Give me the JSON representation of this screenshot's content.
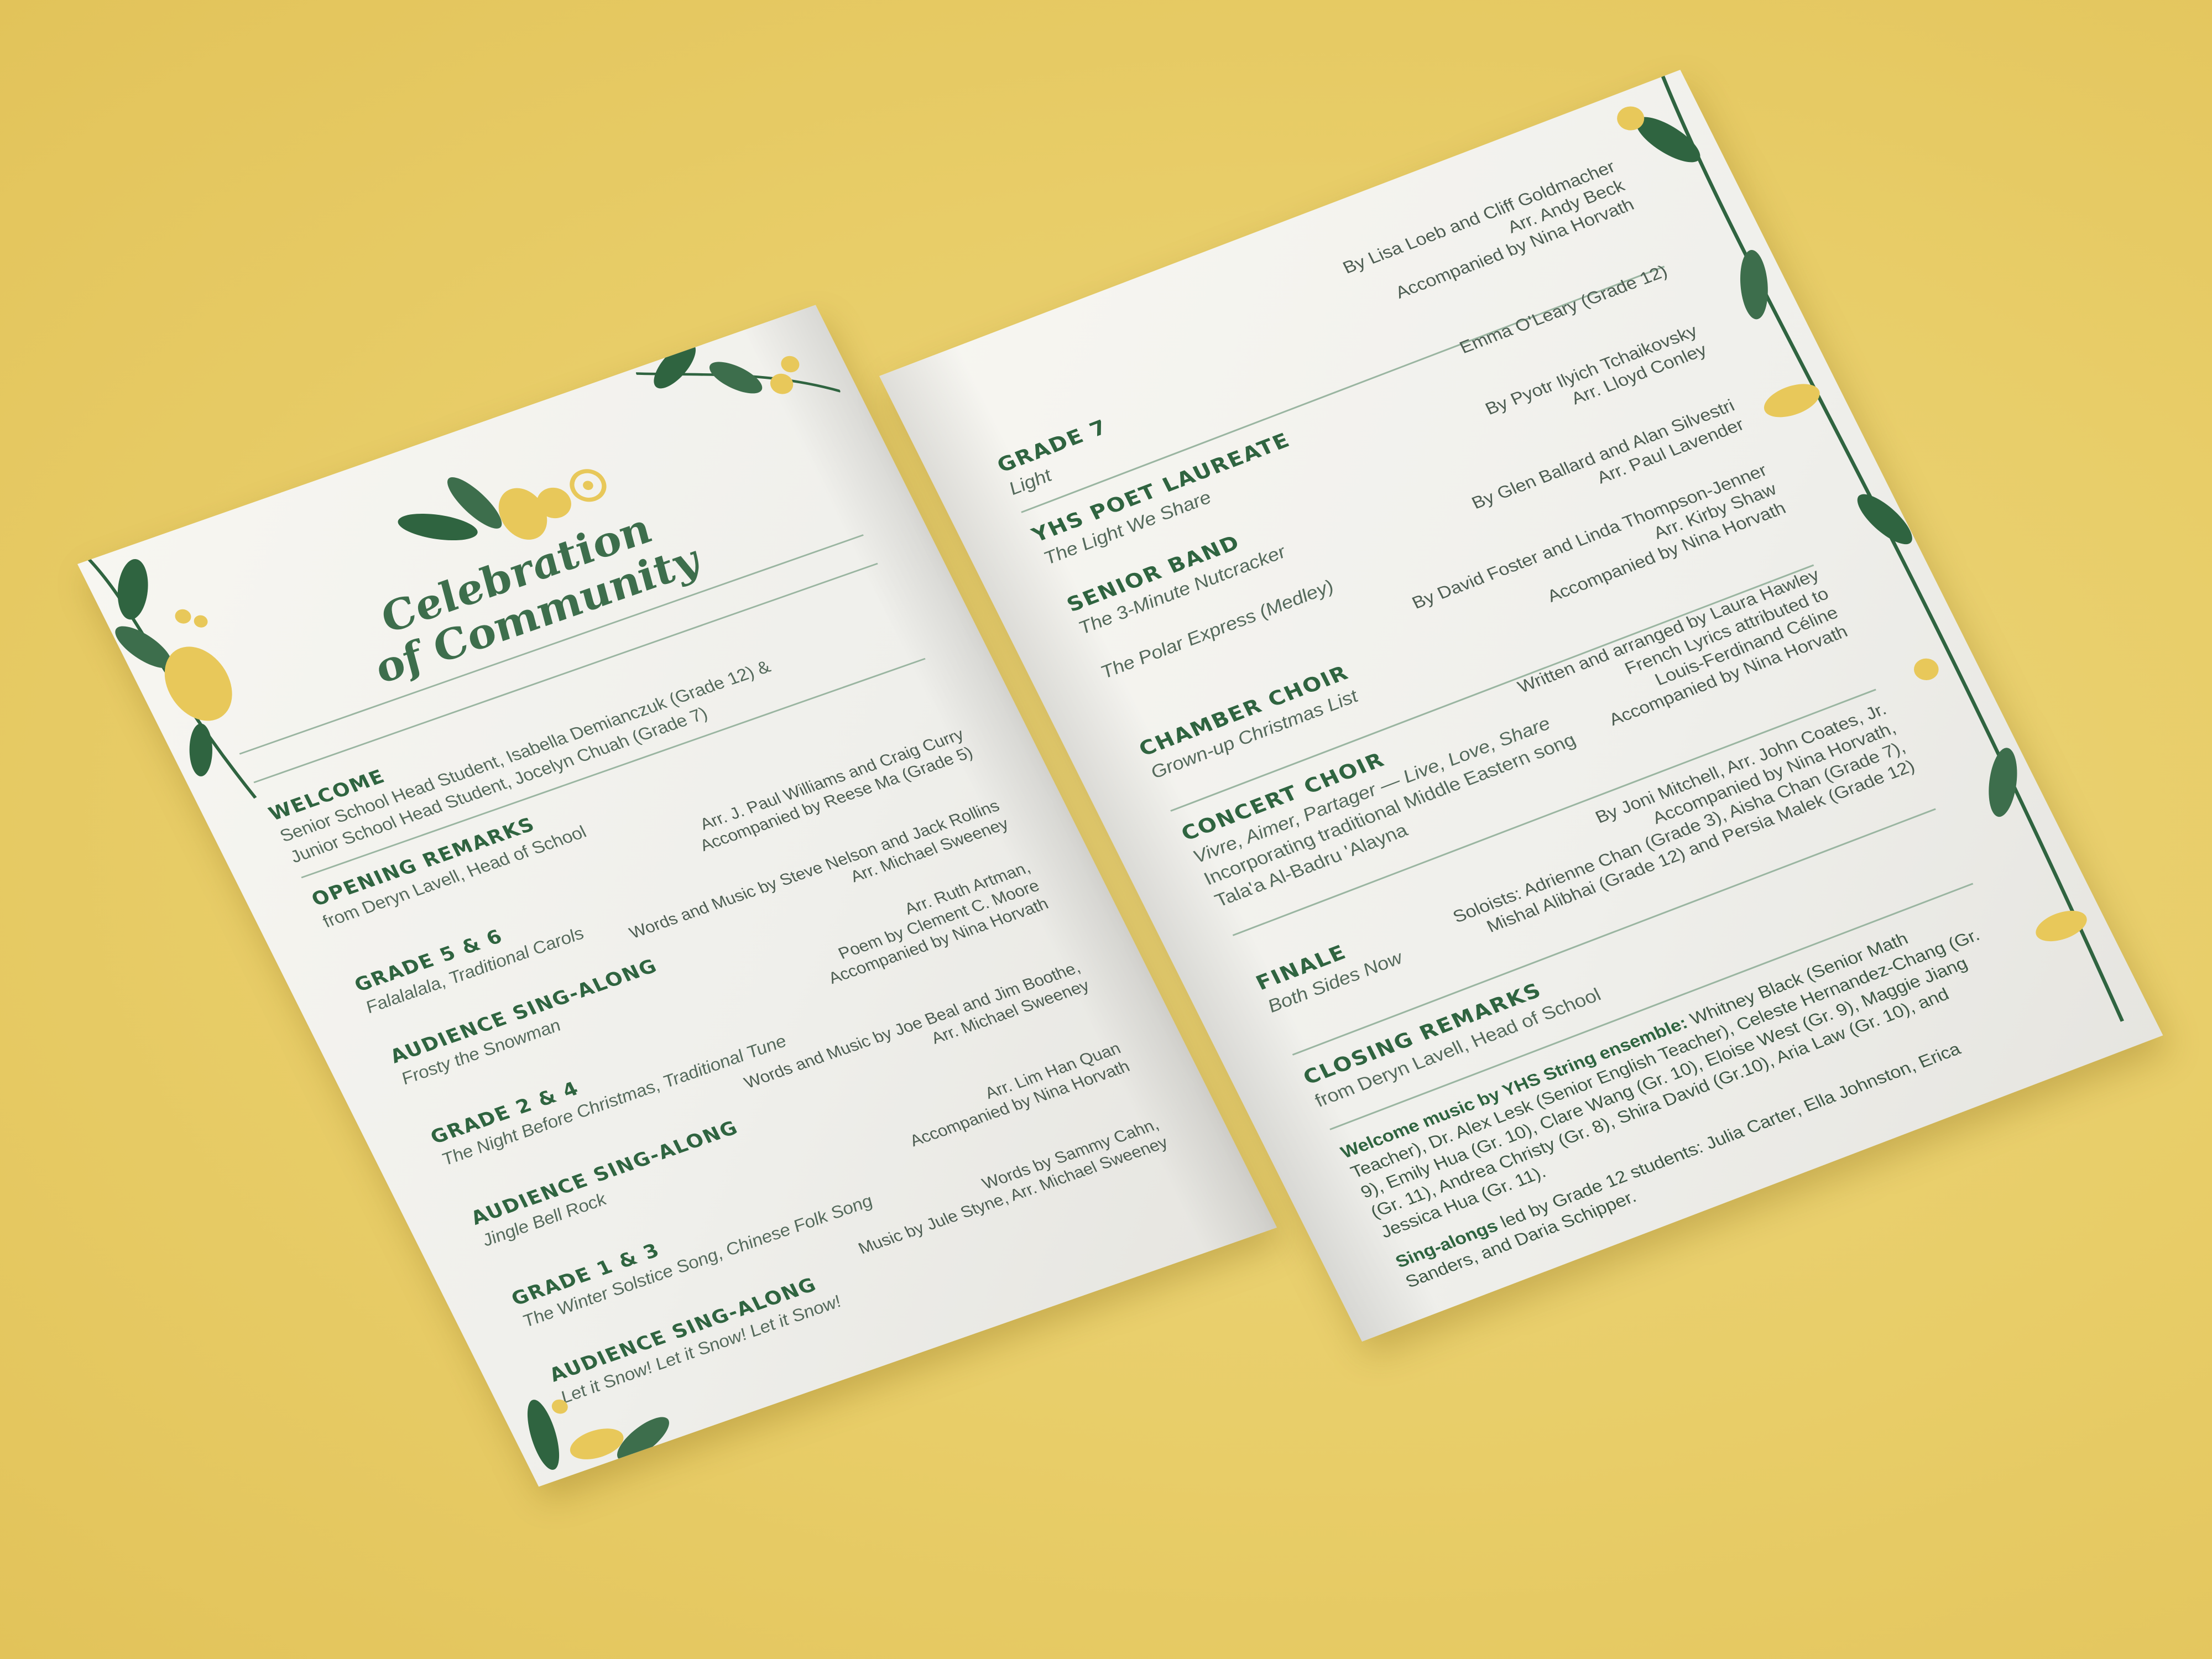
{
  "colors": {
    "background": "#e8cd68",
    "accent_green": "#2f6440",
    "accent_yellow": "#e8c85a",
    "paper": "#f4f3ee"
  },
  "title": {
    "line1": "Celebration",
    "line2": "of Community"
  },
  "left_items": [
    {
      "heading": "WELCOME",
      "sub": [
        "Senior School Head Student, Isabella Demianczuk (Grade 12) &",
        "Junior School Head Student, Jocelyn Chuah (Grade 7)"
      ],
      "credits": []
    },
    {
      "heading": "OPENING REMARKS",
      "sub": [
        "from Deryn Lavell, Head of School"
      ],
      "credits": []
    },
    {
      "heading": "GRADE 5 & 6",
      "sub": [
        "Falalalala, Traditional Carols"
      ],
      "credits": [
        "Arr. J. Paul Williams and Craig Curry",
        "Accompanied by Reese Ma (Grade 5)"
      ]
    },
    {
      "heading": "AUDIENCE SING-ALONG",
      "sub": [
        "Frosty the Snowman"
      ],
      "credits": [
        "Words and Music by Steve Nelson and Jack Rollins",
        "Arr. Michael Sweeney"
      ]
    },
    {
      "heading": "GRADE 2 & 4",
      "sub": [
        "The Night Before Christmas, Traditional Tune"
      ],
      "credits": [
        "Arr. Ruth Artman,",
        "Poem by Clement C. Moore",
        "Accompanied by Nina Horvath"
      ]
    },
    {
      "heading": "AUDIENCE SING-ALONG",
      "sub": [
        "Jingle Bell Rock"
      ],
      "credits": [
        "Words and Music by Joe Beal and Jim Boothe,",
        "Arr. Michael Sweeney"
      ]
    },
    {
      "heading": "GRADE 1 & 3",
      "sub": [
        "The Winter Solstice Song, Chinese Folk Song"
      ],
      "credits": [
        "Arr. Lim Han Quan",
        "Accompanied by Nina Horvath"
      ]
    },
    {
      "heading": "AUDIENCE SING-ALONG",
      "sub": [
        "Let it Snow! Let it Snow! Let it Snow!"
      ],
      "credits": [
        "Words by Sammy Cahn,",
        "Music by Jule Styne, Arr. Michael Sweeney"
      ]
    }
  ],
  "right_items": [
    {
      "heading": "GRADE 7",
      "sub": [
        "Light"
      ],
      "credits": [
        "By Lisa Loeb and Cliff Goldmacher",
        "Arr. Andy Beck",
        "Accompanied by Nina Horvath"
      ]
    },
    {
      "heading": "YHS POET LAUREATE",
      "sub": [
        "The Light We Share"
      ],
      "credits": [
        "Emma O'Leary (Grade 12)"
      ]
    },
    {
      "heading": "SENIOR BAND",
      "sub": [
        "The 3-Minute Nutcracker"
      ],
      "credits": [
        "By Pyotr Ilyich Tchaikovsky",
        "Arr. Lloyd  Conley"
      ]
    },
    {
      "heading": "",
      "sub": [
        "The Polar Express (Medley)"
      ],
      "credits": [
        "By Glen Ballard and Alan Silvestri",
        "Arr. Paul Lavender"
      ]
    },
    {
      "heading": "CHAMBER CHOIR",
      "sub": [
        "Grown-up Christmas List"
      ],
      "credits": [
        "By David Foster and Linda Thompson-Jenner",
        "Arr. Kirby Shaw",
        "Accompanied by Nina Horvath"
      ]
    },
    {
      "heading": "CONCERT CHOIR",
      "sub": [
        "Vivre, Aimer, Partager — Live, Love, Share",
        "Incorporating traditional Middle Eastern song",
        "Tala'a Al-Badru 'Alayna"
      ],
      "credits": [
        "Written and arranged by Laura Hawley",
        "French Lyrics attributed to",
        "Louis-Ferdinand Céline",
        "Accompanied by Nina Horvath"
      ]
    },
    {
      "heading": "FINALE",
      "sub": [
        "Both Sides Now"
      ],
      "credits": [
        "By Joni Mitchell, Arr. John Coates, Jr.",
        "Accompanied by Nina Horvath,",
        "Soloists: Adrienne Chan (Grade 3), Aisha Chan (Grade 7),",
        "Mishal Alibhai (Grade 12) and Persia Malek (Grade 12)"
      ]
    },
    {
      "heading": "CLOSING REMARKS",
      "sub": [
        "from Deryn Lavell, Head of School"
      ],
      "credits": []
    }
  ],
  "closing_note": {
    "welcome_label": "Welcome music by YHS String ensemble:",
    "welcome_text": "Whitney Black (Senior Math Teacher), Dr. Alex Lesk (Senior English Teacher), Celeste Hernandez-Chang (Gr. 9), Emily Hua (Gr. 10), Clare Wang (Gr. 10), Eloise West (Gr. 9), Maggie Jiang (Gr. 11), Andrea Christy (Gr. 8), Shira David (Gr.10), Aria Law (Gr. 10), and Jessica Hua (Gr. 11).",
    "singalong_label": "Sing-alongs",
    "singalong_text": "led by Grade 12 students: Julia Carter, Ella Johnston, Erica Sanders, and Daria Schipper."
  }
}
